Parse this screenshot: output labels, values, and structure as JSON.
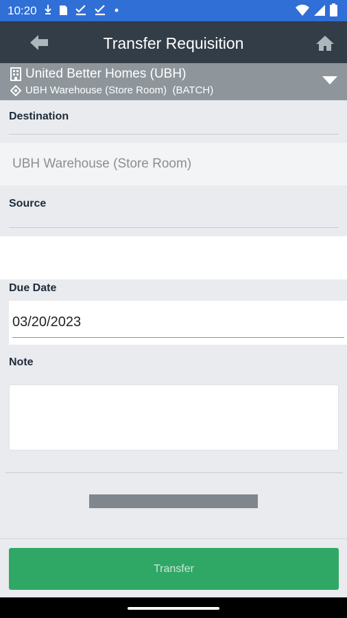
{
  "status_bar": {
    "time": "10:20",
    "icons": [
      "download-icon",
      "sim-card-icon",
      "check-icon",
      "check-icon",
      "dot-icon"
    ],
    "right_icons": [
      "wifi-icon",
      "signal-icon",
      "battery-icon"
    ]
  },
  "app_bar": {
    "title": "Transfer Requisition"
  },
  "context": {
    "organization": "United Better Homes (UBH)",
    "location": "UBH Warehouse (Store Room)  (BATCH)"
  },
  "form": {
    "destination_label": "Destination",
    "destination_value": "UBH Warehouse (Store Room)",
    "source_label": "Source",
    "source_value": "",
    "due_date_label": "Due Date",
    "due_date_value": "03/20/2023",
    "note_label": "Note",
    "note_value": ""
  },
  "footer": {
    "transfer_label": "Transfer"
  },
  "colors": {
    "status_bar": "#2f6fd6",
    "app_bar": "#323d47",
    "context_bar": "#8e969c",
    "transfer_button": "#2fa866"
  }
}
